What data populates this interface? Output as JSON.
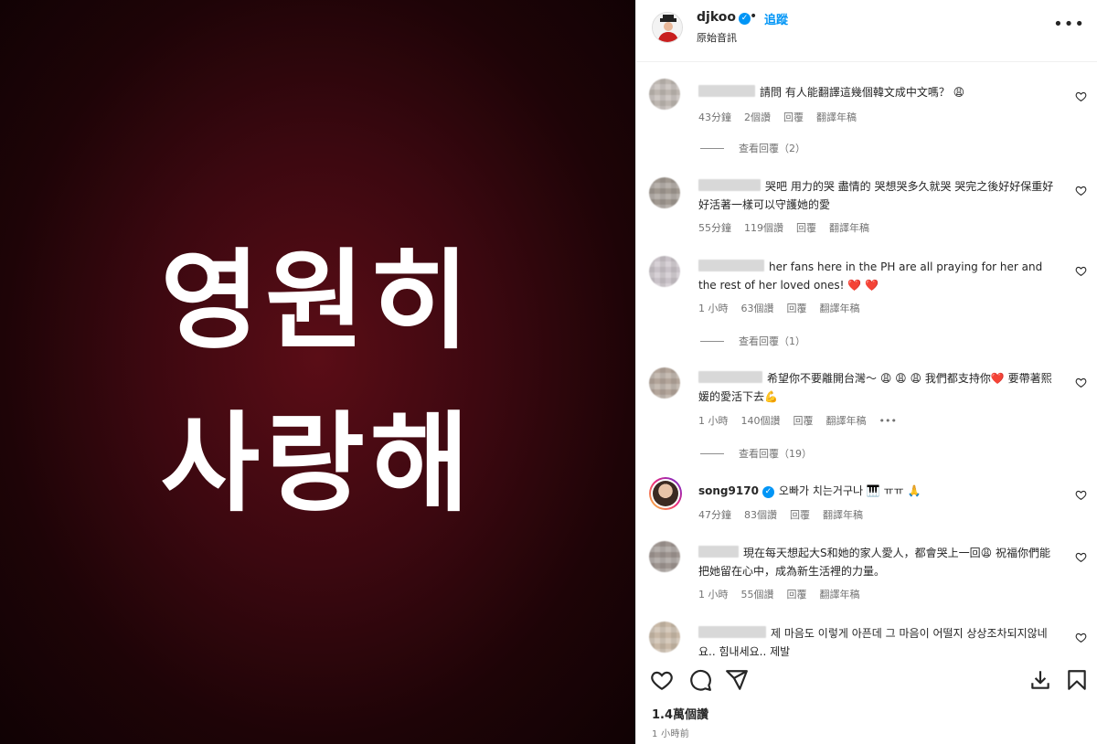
{
  "image": {
    "line1": "영원히",
    "line2": "사랑해"
  },
  "header": {
    "username": "djkoo",
    "separator": "•",
    "follow_label": "追蹤",
    "subtitle": "原始音訊"
  },
  "comments": [
    {
      "text": "請問 有人能翻譯這幾個韓文成中文嗎？",
      "emoji": "😩",
      "time": "43分鐘",
      "likes": "2個讚",
      "reply": "回覆",
      "translate": "翻譯年稿",
      "view_replies": "查看回覆（2）"
    },
    {
      "text": "哭吧 用力的哭 盡情的 哭想哭多久就哭 哭完之後好好保重好好活著一樣可以守護她的愛",
      "time": "55分鐘",
      "likes": "119個讚",
      "reply": "回覆",
      "translate": "翻譯年稿"
    },
    {
      "text": "her fans here in the PH are all praying for her and the rest of her loved ones!",
      "emoji": "❤️ ❤️",
      "time": "1 小時",
      "likes": "63個讚",
      "reply": "回覆",
      "translate": "翻譯年稿",
      "view_replies": "查看回覆（1）"
    },
    {
      "text_a": "希望你不要離開台灣～",
      "emoji_a": "😩 😩 😩",
      "text_b": "我們都支持你",
      "emoji_b": "❤️",
      "text_c": "要帶著熙媛的愛活下去",
      "emoji_c": "💪",
      "time": "1 小時",
      "likes": "140個讚",
      "reply": "回覆",
      "translate": "翻譯年稿",
      "more": "•••",
      "view_replies": "查看回覆（19）"
    },
    {
      "username": "song9170",
      "text": "오빠가 치는거구나",
      "emoji": "🎹 ㅠㅠ 🙏",
      "time": "47分鐘",
      "likes": "83個讚",
      "reply": "回覆",
      "translate": "翻譯年稿"
    },
    {
      "text_a": "現在每天想起大S和她的家人愛人，都會哭上一回",
      "emoji_a": "😩",
      "text_b": "祝福你們能把她留在心中，成為新生活裡的力量。",
      "time": "1 小時",
      "likes": "55個讚",
      "reply": "回覆",
      "translate": "翻譯年稿"
    },
    {
      "text": "제 마음도 이렇게 아픈데 그 마음이 어떨지 상상조차되지않네요.. 힘내세요.. 제발"
    }
  ],
  "footer": {
    "likes": "1.4萬個讚",
    "time": "1 小時前"
  },
  "icons": {
    "like": "heart-icon",
    "comment": "comment-icon",
    "share": "share-icon",
    "download": "download-icon",
    "save": "bookmark-icon"
  }
}
